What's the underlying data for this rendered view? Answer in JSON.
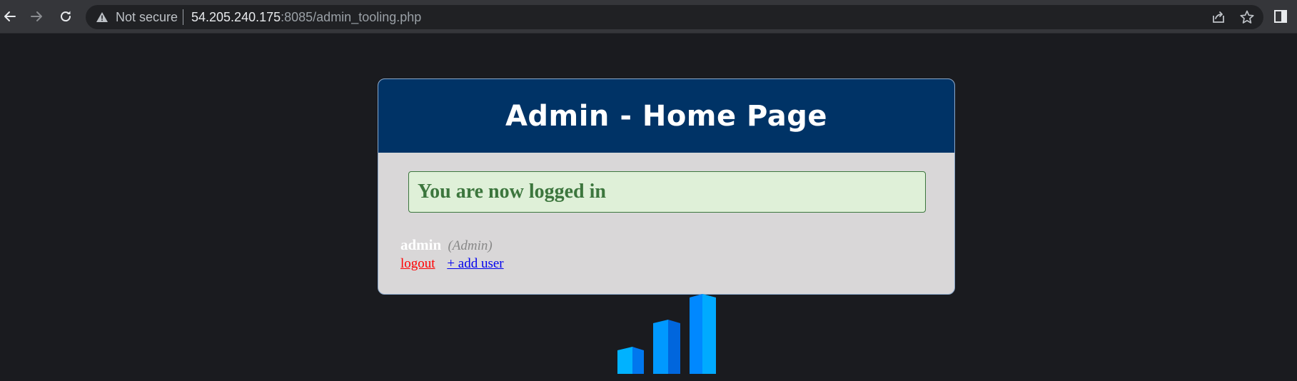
{
  "browser": {
    "security_label": "Not secure",
    "url_host": "54.205.240.175",
    "url_rest": ":8085/admin_tooling.php"
  },
  "page": {
    "title": "Admin - Home Page",
    "success_message": "You are now logged in",
    "user": {
      "name": "admin",
      "role": "(Admin)"
    },
    "links": {
      "logout": "logout",
      "add_user": "+ add user"
    }
  },
  "colors": {
    "header_bg": "#003366",
    "card_bg": "#d9d7d8",
    "success_bg": "#dff0d8",
    "success_text": "#3c763d",
    "logout": "#ff0000",
    "add_user": "#0000ee",
    "page_bg": "#1a1b1f"
  },
  "icons": [
    "back-arrow-icon",
    "forward-arrow-icon",
    "reload-icon",
    "warning-icon",
    "share-icon",
    "star-icon",
    "side-panel-icon",
    "bar-logo-icon"
  ]
}
